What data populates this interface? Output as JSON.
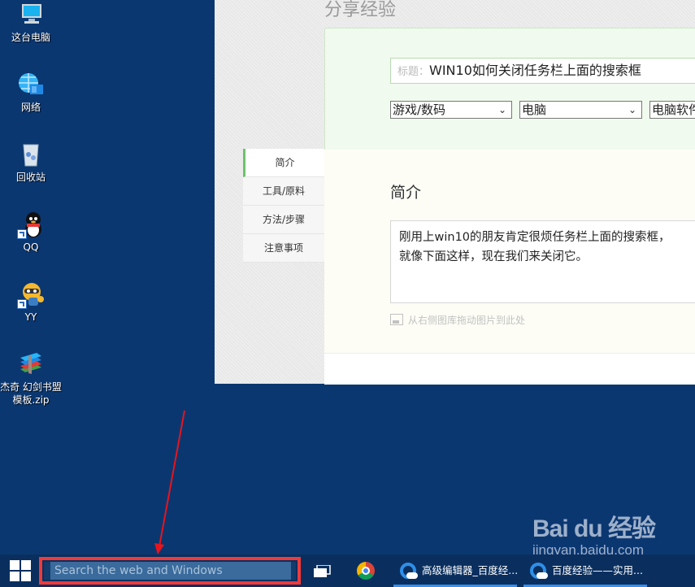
{
  "desktop": {
    "icons": [
      {
        "label": "这台电脑",
        "icon": "computer-icon"
      },
      {
        "label": "网络",
        "icon": "network-icon"
      },
      {
        "label": "回收站",
        "icon": "recycle-bin-icon"
      },
      {
        "label": "QQ",
        "icon": "qq-icon"
      },
      {
        "label": "YY",
        "icon": "yy-icon"
      },
      {
        "label": "杰奇 幻剑书盟模板.zip",
        "icon": "winrar-archive-icon"
      }
    ]
  },
  "editor": {
    "page_title": "分享经验",
    "title_label": "标题：",
    "title_value": "WIN10如何关闭任务栏上面的搜索框",
    "category_selects": [
      "游戏/数码",
      "电脑",
      "电脑软件"
    ],
    "side_nav": [
      {
        "label": "简介",
        "active": true
      },
      {
        "label": "工具/原料",
        "active": false
      },
      {
        "label": "方法/步骤",
        "active": false
      },
      {
        "label": "注意事项",
        "active": false
      }
    ],
    "section_title": "简介",
    "intro_lines": [
      "刚用上win10的朋友肯定很烦任务栏上面的搜索框，",
      "就像下面这样，现在我们来关闭它。"
    ],
    "drag_hint": "从右侧图库拖动图片到此处"
  },
  "taskbar": {
    "search_placeholder": "Search the web and Windows",
    "highlight_color": "#f03a3a",
    "windows": [
      {
        "label": "高级编辑器_百度经...",
        "icon": "browser-cloud-icon"
      },
      {
        "label": "百度经验——实用...",
        "icon": "browser-cloud-icon"
      }
    ]
  },
  "watermark": {
    "logo": "Bai du 经验",
    "url": "jingyan.baidu.com"
  }
}
